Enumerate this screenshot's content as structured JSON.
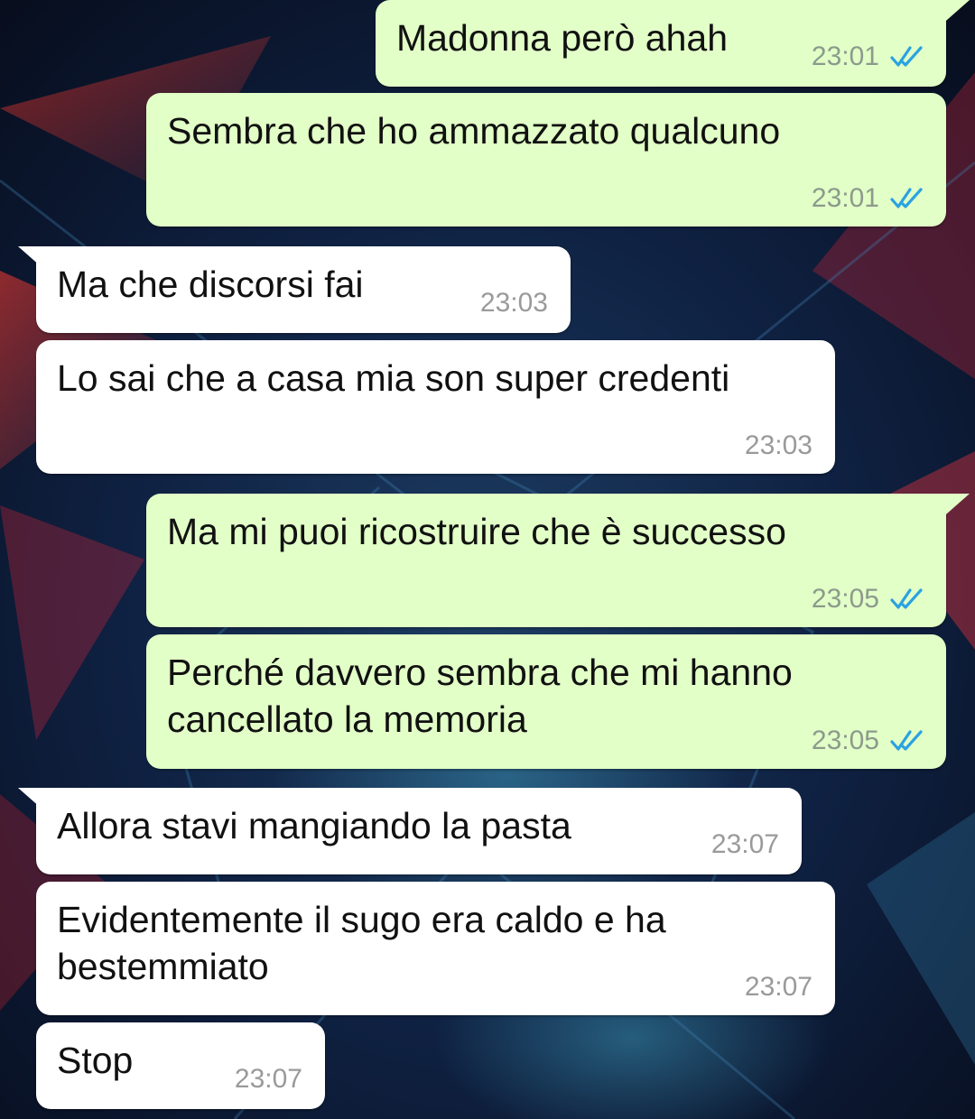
{
  "colors": {
    "outgoing_bubble": "#e2ffc7",
    "incoming_bubble": "#ffffff",
    "read_ticks": "#2aa2e0",
    "timestamp": "#8c9a8c"
  },
  "messages": [
    {
      "direction": "out",
      "text": "Madonna però ahah",
      "time": "23:01",
      "status": "read-double-check-icon"
    },
    {
      "direction": "out",
      "text": "Sembra che ho ammazzato qualcuno",
      "time": "23:01",
      "status": "read-double-check-icon"
    },
    {
      "direction": "in",
      "text": "Ma che discorsi fai",
      "time": "23:03"
    },
    {
      "direction": "in",
      "text": "Lo sai che a casa mia son super credenti",
      "time": "23:03"
    },
    {
      "direction": "out",
      "text": "Ma mi puoi ricostruire che è successo",
      "time": "23:05",
      "status": "read-double-check-icon"
    },
    {
      "direction": "out",
      "text": "Perché davvero sembra che mi hanno\ncancellato la memoria",
      "time": "23:05",
      "status": "read-double-check-icon"
    },
    {
      "direction": "in",
      "text": "Allora stavi mangiando la pasta",
      "time": "23:07"
    },
    {
      "direction": "in",
      "text": "Evidentemente il sugo era caldo e ha\nbestemmiato",
      "time": "23:07"
    },
    {
      "direction": "in",
      "text": "Stop",
      "time": "23:07"
    }
  ]
}
